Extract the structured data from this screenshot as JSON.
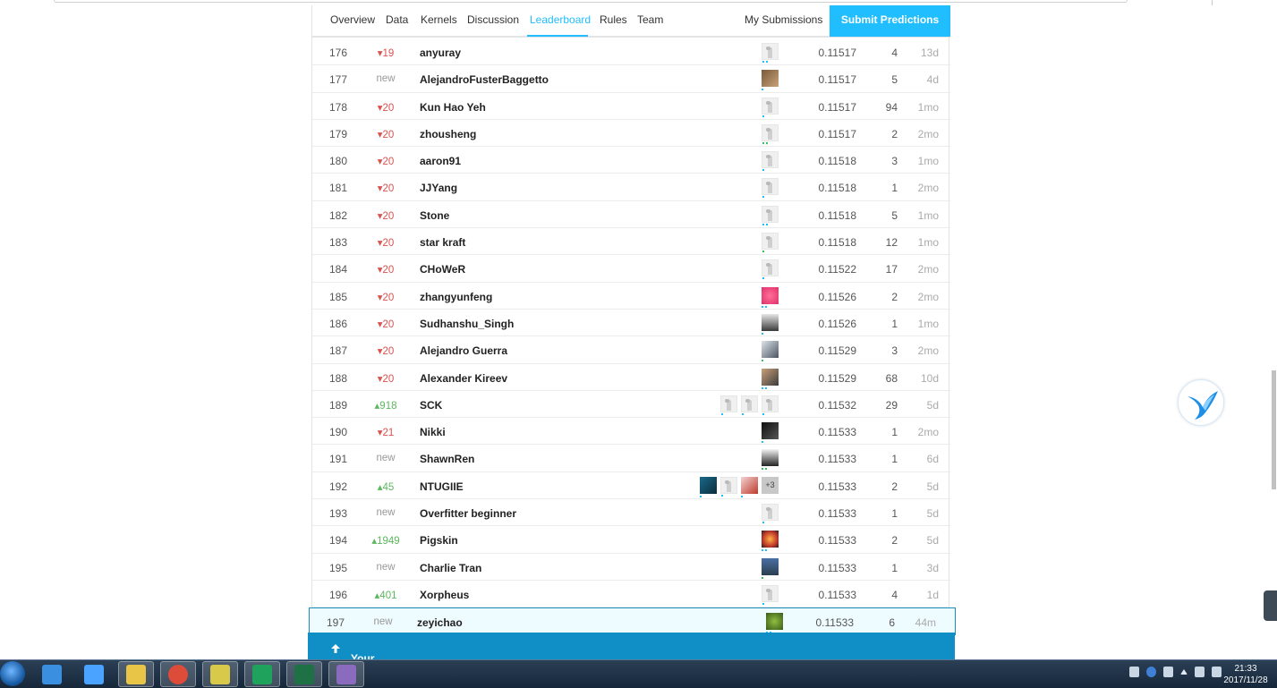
{
  "nav": {
    "tabs": [
      "Overview",
      "Data",
      "Kernels",
      "Discussion",
      "Leaderboard",
      "Rules",
      "Team"
    ],
    "active_tab": "Leaderboard",
    "my_submissions": "My Submissions",
    "submit_label": "Submit Predictions"
  },
  "leaderboard": {
    "rows": [
      {
        "rank": "176",
        "change": "19",
        "dir": "down",
        "team": "anyuray",
        "avatars": [
          "default"
        ],
        "score": "0.11517",
        "entries": "4",
        "last": "13d"
      },
      {
        "rank": "177",
        "change": "new",
        "dir": "new",
        "team": "AlejandroFusterBaggetto",
        "avatars": [
          "photo-brown"
        ],
        "score": "0.11517",
        "entries": "5",
        "last": "4d"
      },
      {
        "rank": "178",
        "change": "20",
        "dir": "down",
        "team": "Kun Hao Yeh",
        "avatars": [
          "default"
        ],
        "score": "0.11517",
        "entries": "94",
        "last": "1mo"
      },
      {
        "rank": "179",
        "change": "20",
        "dir": "down",
        "team": "zhousheng",
        "avatars": [
          "default"
        ],
        "score": "0.11517",
        "entries": "2",
        "last": "2mo"
      },
      {
        "rank": "180",
        "change": "20",
        "dir": "down",
        "team": "aaron91",
        "avatars": [
          "default"
        ],
        "score": "0.11518",
        "entries": "3",
        "last": "1mo"
      },
      {
        "rank": "181",
        "change": "20",
        "dir": "down",
        "team": "JJYang",
        "avatars": [
          "default"
        ],
        "score": "0.11518",
        "entries": "1",
        "last": "2mo"
      },
      {
        "rank": "182",
        "change": "20",
        "dir": "down",
        "team": "Stone",
        "avatars": [
          "default"
        ],
        "score": "0.11518",
        "entries": "5",
        "last": "1mo"
      },
      {
        "rank": "183",
        "change": "20",
        "dir": "down",
        "team": "star kraft",
        "avatars": [
          "default"
        ],
        "score": "0.11518",
        "entries": "12",
        "last": "1mo"
      },
      {
        "rank": "184",
        "change": "20",
        "dir": "down",
        "team": "CHoWeR",
        "avatars": [
          "default"
        ],
        "score": "0.11522",
        "entries": "17",
        "last": "2mo"
      },
      {
        "rank": "185",
        "change": "20",
        "dir": "down",
        "team": "zhangyunfeng",
        "avatars": [
          "photo-pink"
        ],
        "score": "0.11526",
        "entries": "2",
        "last": "2mo"
      },
      {
        "rank": "186",
        "change": "20",
        "dir": "down",
        "team": "Sudhanshu_Singh",
        "avatars": [
          "photo-person"
        ],
        "score": "0.11526",
        "entries": "1",
        "last": "1mo"
      },
      {
        "rank": "187",
        "change": "20",
        "dir": "down",
        "team": "Alejandro Guerra",
        "avatars": [
          "photo-gray"
        ],
        "score": "0.11529",
        "entries": "3",
        "last": "2mo"
      },
      {
        "rank": "188",
        "change": "20",
        "dir": "down",
        "team": "Alexander Kireev",
        "avatars": [
          "photo-face"
        ],
        "score": "0.11529",
        "entries": "68",
        "last": "10d"
      },
      {
        "rank": "189",
        "change": "918",
        "dir": "up",
        "team": "SCK",
        "avatars": [
          "default",
          "default",
          "default"
        ],
        "score": "0.11532",
        "entries": "29",
        "last": "5d"
      },
      {
        "rank": "190",
        "change": "21",
        "dir": "down",
        "team": "Nikki",
        "avatars": [
          "photo-dark"
        ],
        "score": "0.11533",
        "entries": "1",
        "last": "2mo"
      },
      {
        "rank": "191",
        "change": "new",
        "dir": "new",
        "team": "ShawnRen",
        "avatars": [
          "photo-person2"
        ],
        "score": "0.11533",
        "entries": "1",
        "last": "6d"
      },
      {
        "rank": "192",
        "change": "45",
        "dir": "up",
        "team": "NTUGIIE",
        "avatars": [
          "photo-teal",
          "default",
          "photo-red",
          "more"
        ],
        "more_label": "+3",
        "score": "0.11533",
        "entries": "2",
        "last": "5d"
      },
      {
        "rank": "193",
        "change": "new",
        "dir": "new",
        "team": "Overfitter beginner",
        "avatars": [
          "default"
        ],
        "score": "0.11533",
        "entries": "1",
        "last": "5d"
      },
      {
        "rank": "194",
        "change": "1949",
        "dir": "up",
        "team": "Pigskin",
        "avatars": [
          "photo-fire"
        ],
        "score": "0.11533",
        "entries": "2",
        "last": "5d"
      },
      {
        "rank": "195",
        "change": "new",
        "dir": "new",
        "team": "Charlie Tran",
        "avatars": [
          "photo-city"
        ],
        "score": "0.11533",
        "entries": "1",
        "last": "3d"
      },
      {
        "rank": "196",
        "change": "401",
        "dir": "up",
        "team": "Xorpheus",
        "avatars": [
          "default"
        ],
        "score": "0.11533",
        "entries": "4",
        "last": "1d"
      },
      {
        "rank": "197",
        "change": "new",
        "dir": "new",
        "team": "zeyichao",
        "avatars": [
          "photo-green"
        ],
        "score": "0.11533",
        "entries": "6",
        "last": "44m",
        "mine": true
      }
    ]
  },
  "best_entry": {
    "label": "Your Best Entry",
    "icon": "arrow-up-icon"
  },
  "taskbar": {
    "apps": [
      "feige-icon",
      "baidu-netdisk-icon",
      "file-explorer-icon",
      "chrome-icon",
      "folder-icon",
      "pycharm-icon",
      "excel-icon",
      "app-icon"
    ],
    "time": "21:33",
    "date": "2017/11/28"
  },
  "colors": {
    "accent": "#20beff",
    "best_bar": "#0f8fc6",
    "down": "#d9534f",
    "up": "#5cb85c"
  }
}
